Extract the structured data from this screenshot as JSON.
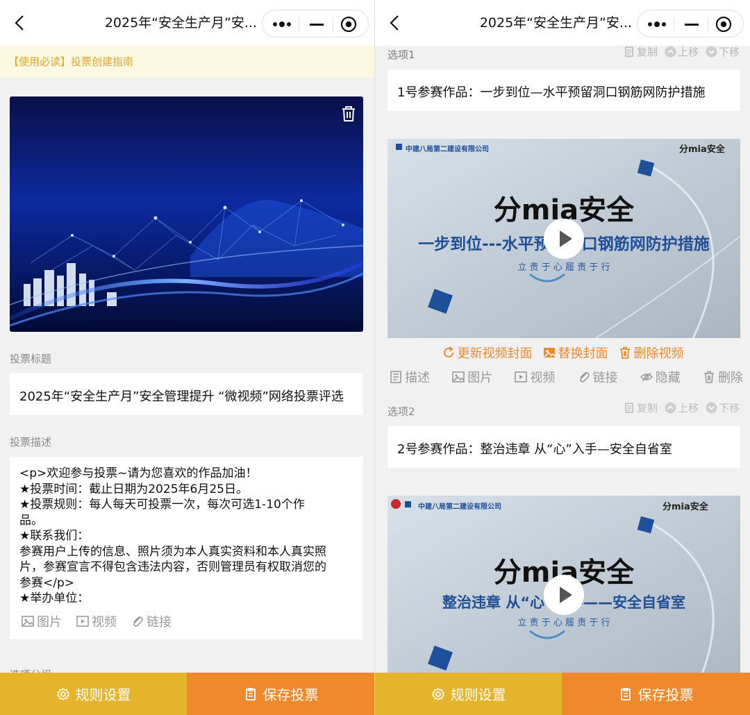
{
  "left": {
    "nav": {
      "title": "2025年“安全生产月”安..."
    },
    "notice": "【使用必读】投票创建指南",
    "title_label": "投票标题",
    "title_value": "2025年“安全生产月”安全管理提升 “微视频”网络投票评选",
    "desc_label": "投票描述",
    "desc_value": "<p>欢迎参与投票~请为您喜欢的作品加油！\n★投票时间：截止日期为2025年6月25日。\n★投票规则：每人每天可投票一次，每次可选1-10个作\n品。\n★联系我们：\n参赛用户上传的信息、照片须为本人真实资料和本人真实照\n片，参赛宣言不得包含违法内容，否则管理员有权取消您的\n参赛</p>\n★举办单位：",
    "desc_tools": {
      "image": "图片",
      "video": "视频",
      "link": "链接"
    },
    "next_label": "选项分组"
  },
  "right": {
    "nav": {
      "title": "2025年“安全生产月”安..."
    },
    "option_actions": {
      "copy": "复制",
      "up": "上移",
      "down": "下移"
    },
    "options": [
      {
        "label": "选项1",
        "name": "1号参赛作品：一步到位—水平预留洞口钢筋网防护措施",
        "video": {
          "company": "中建八局第二建设有限公司",
          "logo": "分mia安全",
          "headline": "一步到位---水平预留洞口钢筋网防护措施",
          "slogan": "立 责 于 心   履 责 于 行"
        },
        "video_actions": {
          "update_cover": "更新视频封面",
          "replace_cover": "替换封面",
          "delete_video": "删除视频"
        },
        "tools": {
          "desc": "描述",
          "image": "图片",
          "video": "视频",
          "link": "链接",
          "hide": "隐藏",
          "delete": "删除"
        }
      },
      {
        "label": "选项2",
        "name": "2号参赛作品：整治违章 从“心”入手—安全自省室",
        "video": {
          "company": "中建八局第二建设有限公司",
          "logo": "分mia安全",
          "headline": "整治违章 从“心”入手——安全自省室",
          "slogan": "立 责 于 心   履 责 于 行"
        }
      }
    ]
  },
  "bottom": {
    "rule": "规则设置",
    "save": "保存投票"
  },
  "colors": {
    "accent_orange": "#f0892b",
    "accent_yellow": "#e6b42a",
    "notice_text": "#e5a52a",
    "notice_bg": "#fdf8e2"
  },
  "icons": [
    "back-icon",
    "more-icon",
    "minimize-icon",
    "close-icon",
    "trash-icon",
    "image-icon",
    "video-icon",
    "link-icon",
    "copy-icon",
    "up-icon",
    "down-icon",
    "refresh-icon",
    "picture-icon",
    "desc-icon",
    "hide-icon",
    "gear-icon",
    "clipboard-icon",
    "play-icon"
  ]
}
